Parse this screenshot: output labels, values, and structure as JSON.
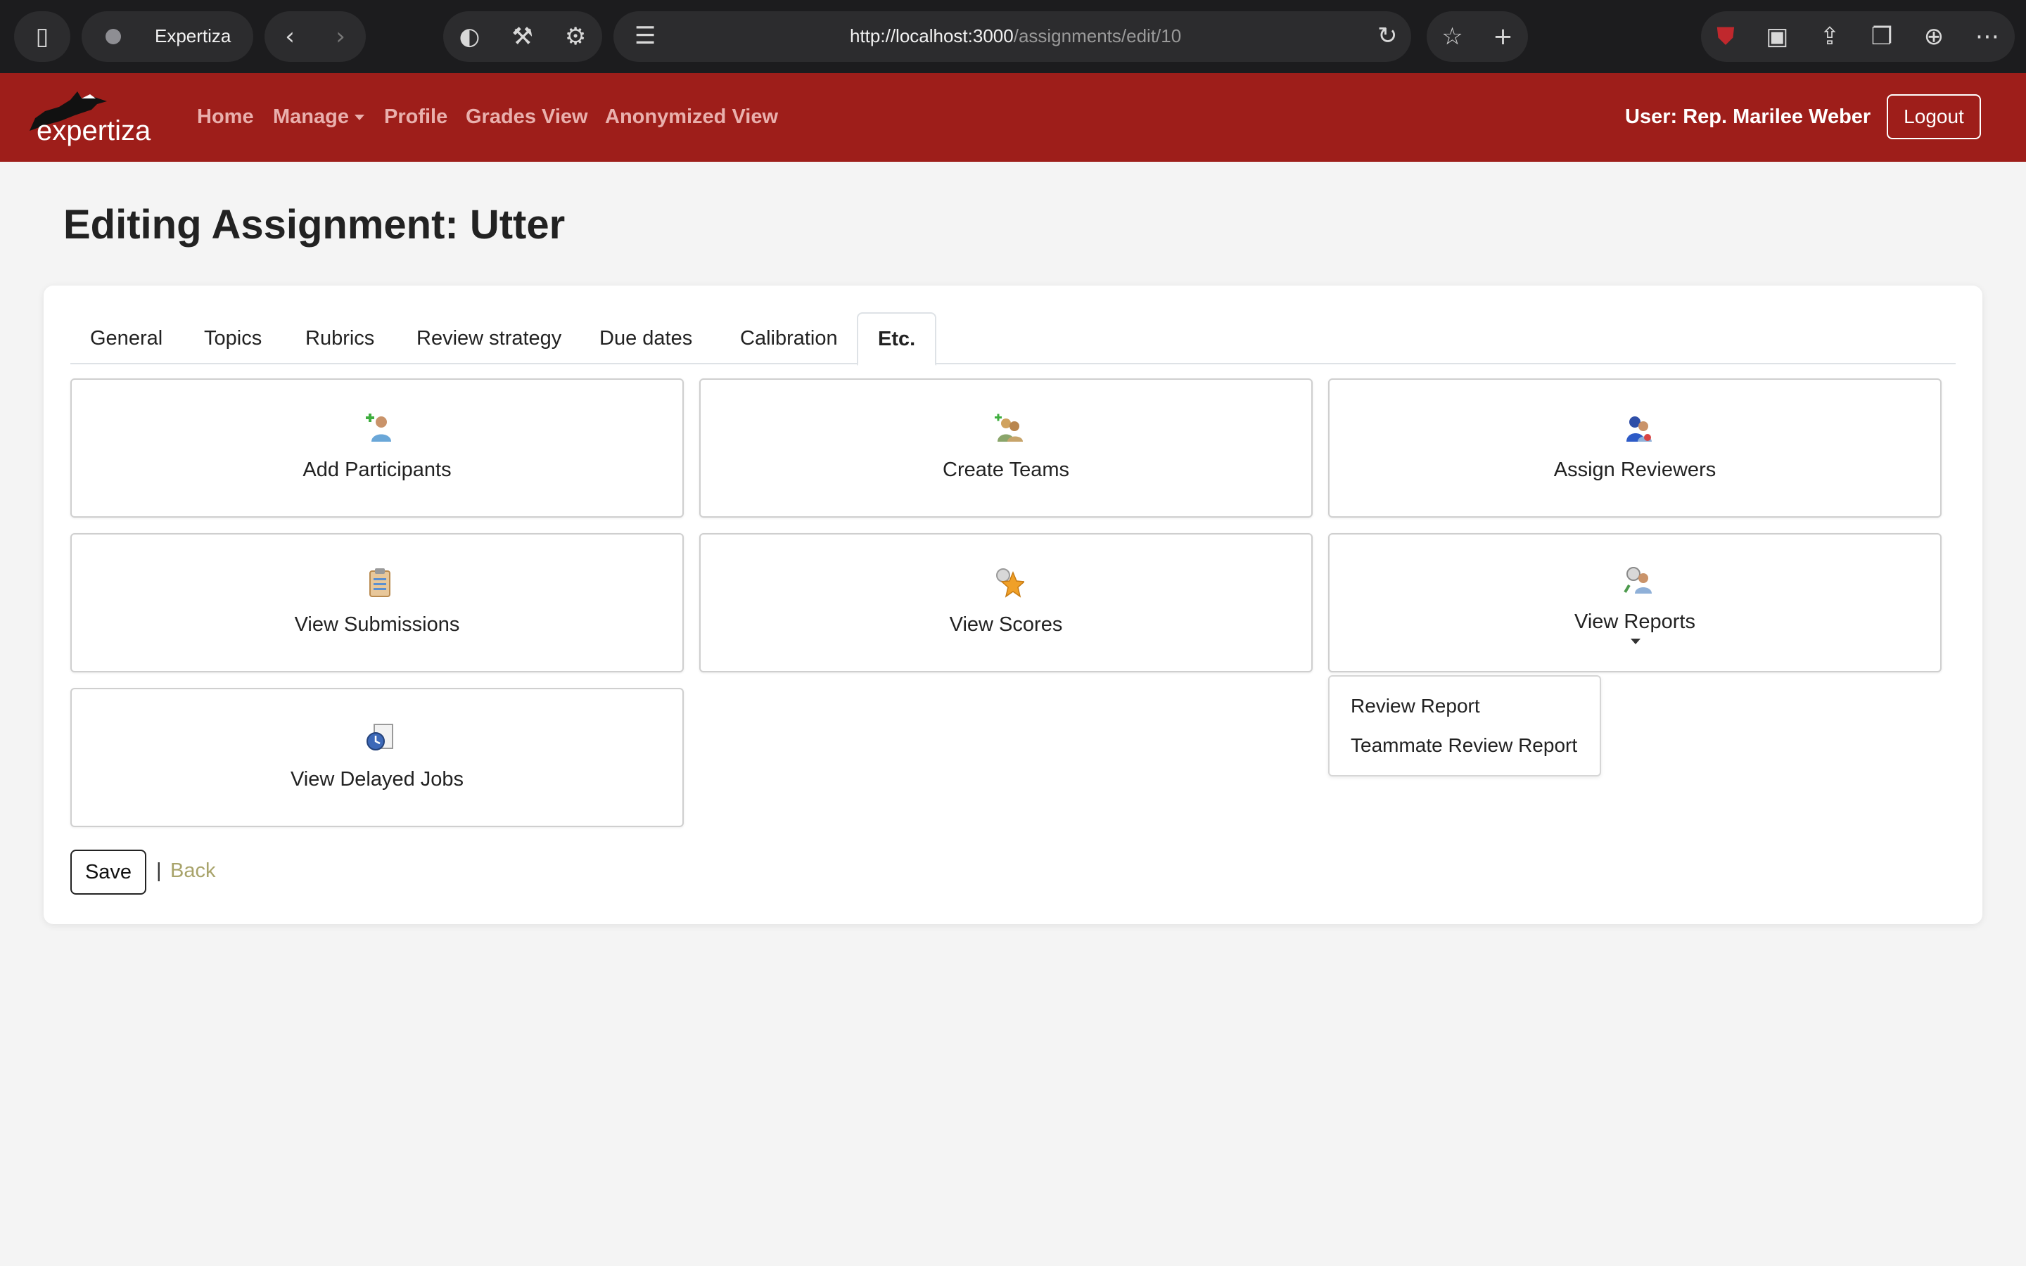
{
  "browser": {
    "tab_title": "Expertiza",
    "url_host": "http://localhost:3000",
    "url_path": "/assignments/edit/10"
  },
  "navbar": {
    "logo_text": "expertiza",
    "links": [
      "Home",
      "Manage",
      "Profile",
      "Grades View",
      "Anonymized View"
    ],
    "user": "User: Rep. Marilee Weber",
    "logout": "Logout"
  },
  "page": {
    "title": "Editing Assignment: Utter"
  },
  "tabs": [
    "General",
    "Topics",
    "Rubrics",
    "Review strategy",
    "Due dates",
    "Calibration",
    "Etc."
  ],
  "active_tab": "Etc.",
  "tiles": [
    {
      "label": "Add Participants",
      "icon": "add-participants-icon"
    },
    {
      "label": "Create Teams",
      "icon": "create-teams-icon"
    },
    {
      "label": "Assign Reviewers",
      "icon": "assign-reviewers-icon"
    },
    {
      "label": "View Submissions",
      "icon": "clipboard-icon"
    },
    {
      "label": "View Scores",
      "icon": "star-icon"
    },
    {
      "label": "View Reports",
      "icon": "reports-icon"
    },
    {
      "label": "View Delayed Jobs",
      "icon": "clock-icon"
    }
  ],
  "reports_menu": [
    "Review Report",
    "Teammate Review Report"
  ],
  "actions": {
    "save": "Save",
    "separator": "|",
    "back": "Back"
  },
  "colors": {
    "navbar": "#9e1e1a",
    "nav_link": "#e9b0ad",
    "back_link": "#a8a36a"
  }
}
